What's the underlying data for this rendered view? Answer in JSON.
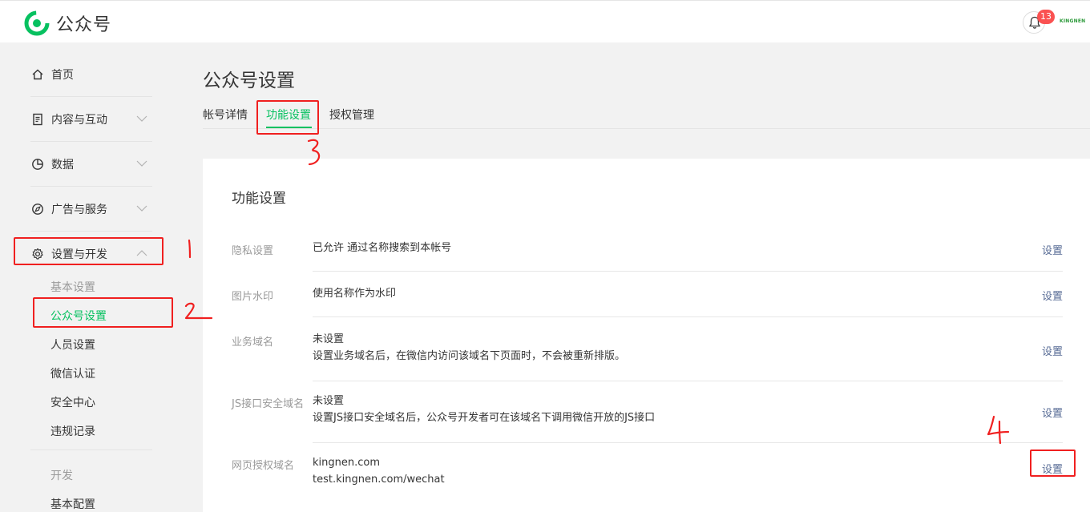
{
  "app": {
    "title": "公众号"
  },
  "header": {
    "notification_count": "13",
    "account_name": "KINGNEN"
  },
  "sidebar": {
    "items": [
      {
        "label": "首页"
      },
      {
        "label": "内容与互动"
      },
      {
        "label": "数据"
      },
      {
        "label": "广告与服务"
      },
      {
        "label": "设置与开发"
      }
    ],
    "settings_subitems": [
      {
        "label": "基本设置"
      },
      {
        "label": "公众号设置"
      },
      {
        "label": "人员设置"
      },
      {
        "label": "微信认证"
      },
      {
        "label": "安全中心"
      },
      {
        "label": "违规记录"
      }
    ],
    "dev_group": {
      "label": "开发"
    },
    "dev_subitems": [
      {
        "label": "基本配置"
      }
    ]
  },
  "main": {
    "title": "公众号设置",
    "tabs": [
      {
        "label": "帐号详情"
      },
      {
        "label": "功能设置"
      },
      {
        "label": "授权管理"
      }
    ],
    "card_title": "功能设置",
    "rows": [
      {
        "label": "隐私设置",
        "lines": [
          "已允许 通过名称搜索到本帐号"
        ],
        "action": "设置"
      },
      {
        "label": "图片水印",
        "lines": [
          "使用名称作为水印"
        ],
        "action": "设置"
      },
      {
        "label": "业务域名",
        "lines": [
          "未设置",
          "设置业务域名后，在微信内访问该域名下页面时，不会被重新排版。"
        ],
        "action": "设置"
      },
      {
        "label": "JS接口安全域名",
        "lines": [
          "未设置",
          "设置JS接口安全域名后，公众号开发者可在该域名下调用微信开放的JS接口"
        ],
        "action": "设置"
      },
      {
        "label": "网页授权域名",
        "lines": [
          "kingnen.com",
          "test.kingnen.com/wechat"
        ],
        "action": "设置"
      }
    ]
  },
  "colors": {
    "accent": "#07c160",
    "annotation": "#f02020",
    "link": "#576b95"
  }
}
